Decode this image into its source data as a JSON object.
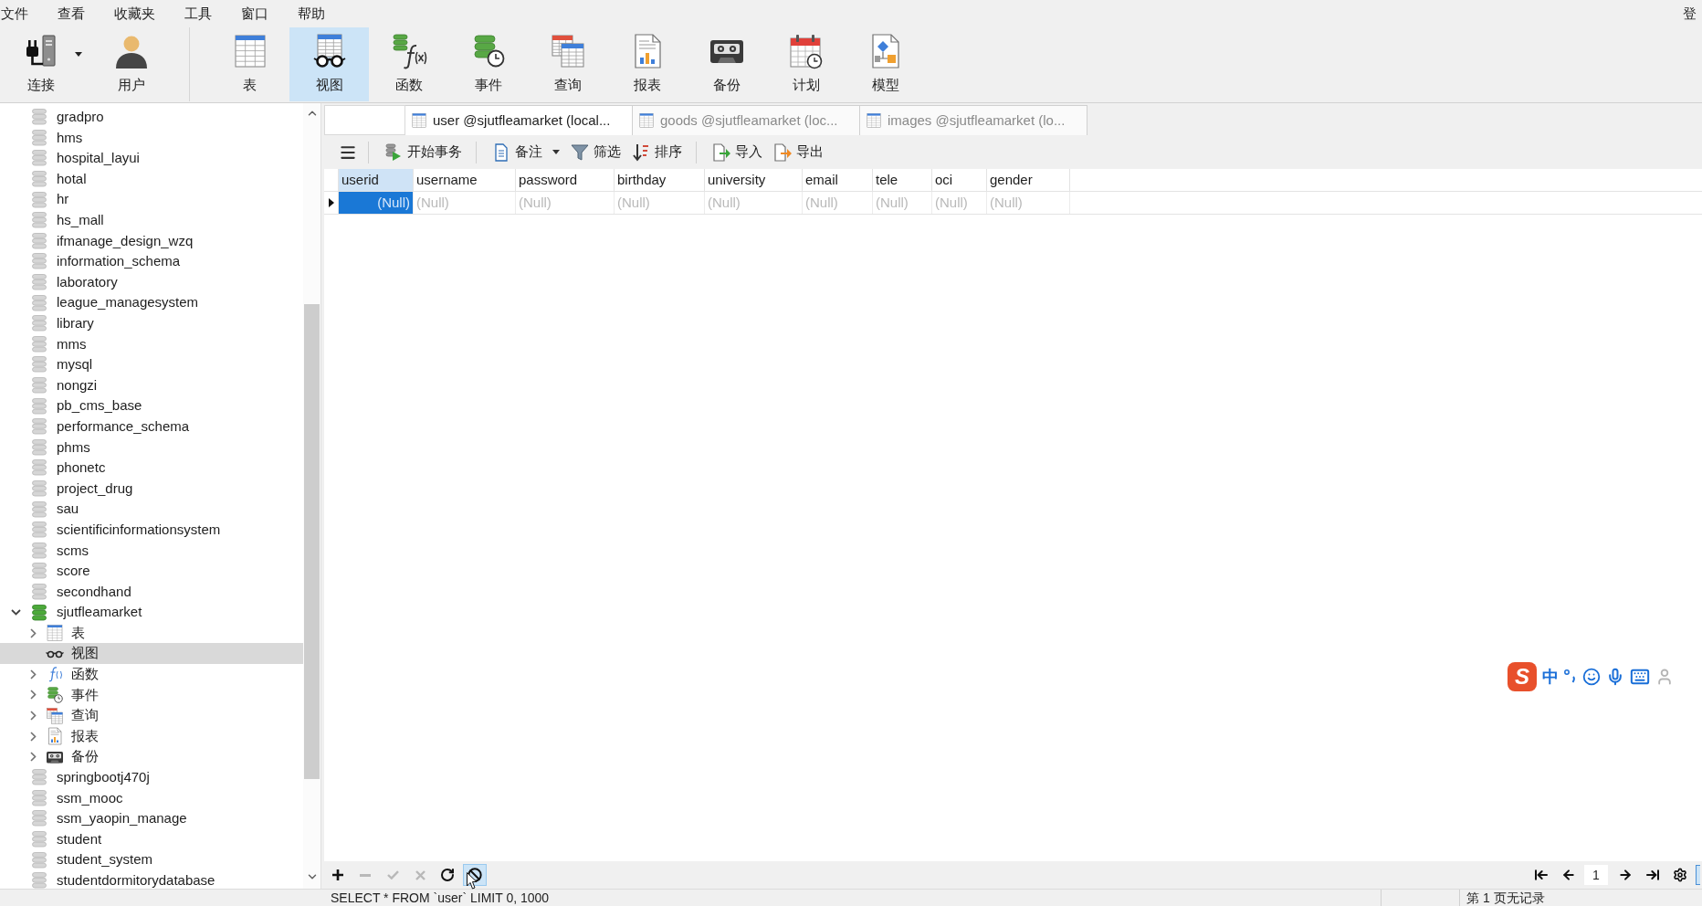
{
  "menu_bar": {
    "items": [
      "文件",
      "查看",
      "收藏夹",
      "工具",
      "窗口",
      "帮助"
    ],
    "right_item": "登"
  },
  "toolbar": {
    "groups": [
      [
        {
          "label": "连接",
          "kind": "connection",
          "selected": false,
          "dropdown": true
        },
        {
          "label": "用户",
          "kind": "user",
          "selected": false,
          "dropdown": false
        }
      ],
      [
        {
          "label": "表",
          "kind": "table",
          "selected": false,
          "dropdown": false
        },
        {
          "label": "视图",
          "kind": "view",
          "selected": true,
          "dropdown": false
        },
        {
          "label": "函数",
          "kind": "function",
          "selected": false,
          "dropdown": false
        },
        {
          "label": "事件",
          "kind": "event",
          "selected": false,
          "dropdown": false
        },
        {
          "label": "查询",
          "kind": "query",
          "selected": false,
          "dropdown": false
        },
        {
          "label": "报表",
          "kind": "report",
          "selected": false,
          "dropdown": false
        },
        {
          "label": "备份",
          "kind": "backup",
          "selected": false,
          "dropdown": false
        },
        {
          "label": "计划",
          "kind": "schedule",
          "selected": false,
          "dropdown": false
        },
        {
          "label": "模型",
          "kind": "model",
          "selected": false,
          "dropdown": false
        }
      ]
    ]
  },
  "navigator": {
    "items": [
      {
        "label": "gradpro",
        "open": false,
        "expandable": false,
        "selected": false
      },
      {
        "label": "hms",
        "open": false,
        "expandable": false,
        "selected": false
      },
      {
        "label": "hospital_layui",
        "open": false,
        "expandable": false,
        "selected": false
      },
      {
        "label": "hotal",
        "open": false,
        "expandable": false,
        "selected": false
      },
      {
        "label": "hr",
        "open": false,
        "expandable": false,
        "selected": false
      },
      {
        "label": "hs_mall",
        "open": false,
        "expandable": false,
        "selected": false
      },
      {
        "label": "ifmanage_design_wzq",
        "open": false,
        "expandable": false,
        "selected": false
      },
      {
        "label": "information_schema",
        "open": false,
        "expandable": false,
        "selected": false
      },
      {
        "label": "laboratory",
        "open": false,
        "expandable": false,
        "selected": false
      },
      {
        "label": "league_managesystem",
        "open": false,
        "expandable": false,
        "selected": false
      },
      {
        "label": "library",
        "open": false,
        "expandable": false,
        "selected": false
      },
      {
        "label": "mms",
        "open": false,
        "expandable": false,
        "selected": false
      },
      {
        "label": "mysql",
        "open": false,
        "expandable": false,
        "selected": false
      },
      {
        "label": "nongzi",
        "open": false,
        "expandable": false,
        "selected": false
      },
      {
        "label": "pb_cms_base",
        "open": false,
        "expandable": false,
        "selected": false
      },
      {
        "label": "performance_schema",
        "open": false,
        "expandable": false,
        "selected": false
      },
      {
        "label": "phms",
        "open": false,
        "expandable": false,
        "selected": false
      },
      {
        "label": "phonetc",
        "open": false,
        "expandable": false,
        "selected": false
      },
      {
        "label": "project_drug",
        "open": false,
        "expandable": false,
        "selected": false
      },
      {
        "label": "sau",
        "open": false,
        "expandable": false,
        "selected": false
      },
      {
        "label": "scientificinformationsystem",
        "open": false,
        "expandable": false,
        "selected": false
      },
      {
        "label": "scms",
        "open": false,
        "expandable": false,
        "selected": false
      },
      {
        "label": "score",
        "open": false,
        "expandable": false,
        "selected": false
      },
      {
        "label": "secondhand",
        "open": false,
        "expandable": false,
        "selected": false
      },
      {
        "label": "sjutfleamarket",
        "open": true,
        "expandable": true,
        "expanded": true,
        "selected": false,
        "children": [
          {
            "label": "表",
            "kind": "table",
            "expandable": true,
            "expanded": false,
            "selected": false
          },
          {
            "label": "视图",
            "kind": "view",
            "expandable": false,
            "selected": true
          },
          {
            "label": "函数",
            "kind": "function",
            "expandable": true,
            "expanded": false,
            "selected": false
          },
          {
            "label": "事件",
            "kind": "event",
            "expandable": true,
            "expanded": false,
            "selected": false
          },
          {
            "label": "查询",
            "kind": "query",
            "expandable": true,
            "expanded": false,
            "selected": false
          },
          {
            "label": "报表",
            "kind": "report",
            "expandable": true,
            "expanded": false,
            "selected": false
          },
          {
            "label": "备份",
            "kind": "backup",
            "expandable": true,
            "expanded": false,
            "selected": false
          }
        ]
      },
      {
        "label": "springbootj470j",
        "open": false,
        "expandable": false,
        "selected": false
      },
      {
        "label": "ssm_mooc",
        "open": false,
        "expandable": false,
        "selected": false
      },
      {
        "label": "ssm_yaopin_manage",
        "open": false,
        "expandable": false,
        "selected": false
      },
      {
        "label": "student",
        "open": false,
        "expandable": false,
        "selected": false
      },
      {
        "label": "student_system",
        "open": false,
        "expandable": false,
        "selected": false
      },
      {
        "label": "studentdormitorydatabase",
        "open": false,
        "expandable": false,
        "selected": false
      }
    ]
  },
  "editor": {
    "tabs": [
      {
        "label": "user @sjutfleamarket (local...",
        "selected": true
      },
      {
        "label": "goods @sjutfleamarket (loc...",
        "selected": false
      },
      {
        "label": "images @sjutfleamarket (lo...",
        "selected": false
      }
    ],
    "toolbar": {
      "groups": [
        [
          {
            "label": "开始事务",
            "kind": "transaction",
            "dropdown": false
          }
        ],
        [
          {
            "label": "备注",
            "kind": "note",
            "dropdown": true
          },
          {
            "label": "筛选",
            "kind": "filter",
            "dropdown": false
          },
          {
            "label": "排序",
            "kind": "sort",
            "dropdown": false
          }
        ],
        [
          {
            "label": "导入",
            "kind": "import",
            "dropdown": false
          },
          {
            "label": "导出",
            "kind": "export",
            "dropdown": false
          }
        ]
      ]
    },
    "grid": {
      "columns": [
        {
          "label": "userid",
          "selected": true
        },
        {
          "label": "username",
          "selected": false
        },
        {
          "label": "password",
          "selected": false
        },
        {
          "label": "birthday",
          "selected": false
        },
        {
          "label": "university",
          "selected": false
        },
        {
          "label": "email",
          "selected": false
        },
        {
          "label": "tele",
          "selected": false
        },
        {
          "label": "oci",
          "selected": false
        },
        {
          "label": "gender",
          "selected": false
        }
      ],
      "rows": [
        {
          "current": true,
          "cells": [
            {
              "value": "(Null)",
              "selected": true
            },
            {
              "value": "(Null)",
              "selected": false
            },
            {
              "value": "(Null)",
              "selected": false
            },
            {
              "value": "(Null)",
              "selected": false
            },
            {
              "value": "(Null)",
              "selected": false
            },
            {
              "value": "(Null)",
              "selected": false
            },
            {
              "value": "(Null)",
              "selected": false
            },
            {
              "value": "(Null)",
              "selected": false
            },
            {
              "value": "(Null)",
              "selected": false
            }
          ]
        }
      ]
    },
    "bottom_toolbar": {
      "edit_buttons": [
        {
          "kind": "add",
          "disabled": false,
          "hovered": false
        },
        {
          "kind": "delete",
          "disabled": true,
          "hovered": false
        },
        {
          "kind": "apply",
          "disabled": true,
          "hovered": false
        },
        {
          "kind": "discard",
          "disabled": true,
          "hovered": false
        },
        {
          "kind": "refresh",
          "disabled": false,
          "hovered": false
        },
        {
          "kind": "stop",
          "disabled": false,
          "hovered": true
        }
      ],
      "pager": {
        "before": [
          {
            "kind": "first"
          },
          {
            "kind": "previous"
          }
        ],
        "page": "1",
        "after": [
          {
            "kind": "next"
          },
          {
            "kind": "last"
          },
          {
            "kind": "settings"
          }
        ]
      }
    }
  },
  "ime_toolbar": {
    "logo": "S",
    "mode": "中"
  },
  "status_bar": {
    "sql": "SELECT * FROM `user` LIMIT 0, 1000",
    "page_info": "第 1 页无记录"
  }
}
